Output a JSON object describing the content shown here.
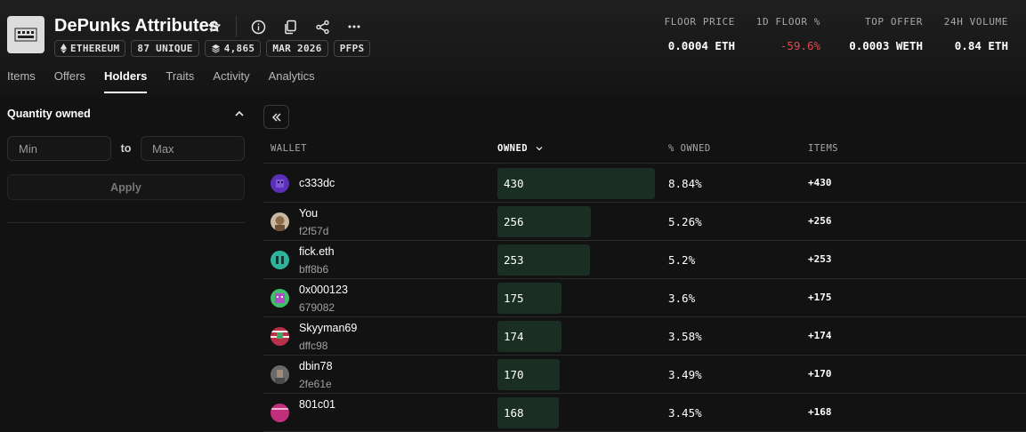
{
  "collection": {
    "title": "DePunks Attributes",
    "badges": [
      {
        "label": "ETHEREUM",
        "icon": "ethereum-icon"
      },
      {
        "label": "87 UNIQUE",
        "icon": ""
      },
      {
        "label": "4,865",
        "icon": "layers-icon"
      },
      {
        "label": "MAR 2026",
        "icon": ""
      },
      {
        "label": "PFPS",
        "icon": ""
      }
    ]
  },
  "stats": {
    "floor_price": {
      "label": "FLOOR PRICE",
      "value": "0.0004 ETH"
    },
    "floor_change": {
      "label": "1D FLOOR %",
      "value": "-59.6%"
    },
    "top_offer": {
      "label": "TOP OFFER",
      "value": "0.0003 WETH"
    },
    "volume": {
      "label": "24H VOLUME",
      "value": "0.84 ETH"
    }
  },
  "tabs": [
    "Items",
    "Offers",
    "Holders",
    "Traits",
    "Activity",
    "Analytics"
  ],
  "active_tab": "Holders",
  "filter": {
    "title": "Quantity owned",
    "min_placeholder": "Min",
    "max_placeholder": "Max",
    "to_label": "to",
    "apply_label": "Apply"
  },
  "table": {
    "headers": {
      "wallet": "WALLET",
      "owned": "OWNED",
      "pct": "% OWNED",
      "items": "ITEMS"
    },
    "rows": [
      {
        "name": "c333dc",
        "address": "",
        "owned": "430",
        "owned_fraction": 1.0,
        "pct": "8.84%",
        "items": "+430"
      },
      {
        "name": "You",
        "address": "f2f57d",
        "owned": "256",
        "owned_fraction": 0.595,
        "pct": "5.26%",
        "items": "+256"
      },
      {
        "name": "fick.eth",
        "address": "bff8b6",
        "owned": "253",
        "owned_fraction": 0.588,
        "pct": "5.2%",
        "items": "+253"
      },
      {
        "name": "0x000123",
        "address": "679082",
        "owned": "175",
        "owned_fraction": 0.407,
        "pct": "3.6%",
        "items": "+175"
      },
      {
        "name": "Skyyman69",
        "address": "dffc98",
        "owned": "174",
        "owned_fraction": 0.405,
        "pct": "3.58%",
        "items": "+174"
      },
      {
        "name": "dbin78",
        "address": "2fe61e",
        "owned": "170",
        "owned_fraction": 0.395,
        "pct": "3.49%",
        "items": "+170"
      },
      {
        "name": "801c01",
        "address": "",
        "owned": "168",
        "owned_fraction": 0.391,
        "pct": "3.45%",
        "items": "+168"
      }
    ]
  },
  "colors": {
    "background": "#121212",
    "bar_fill": "#1a2e23",
    "negative": "#e5484d"
  }
}
